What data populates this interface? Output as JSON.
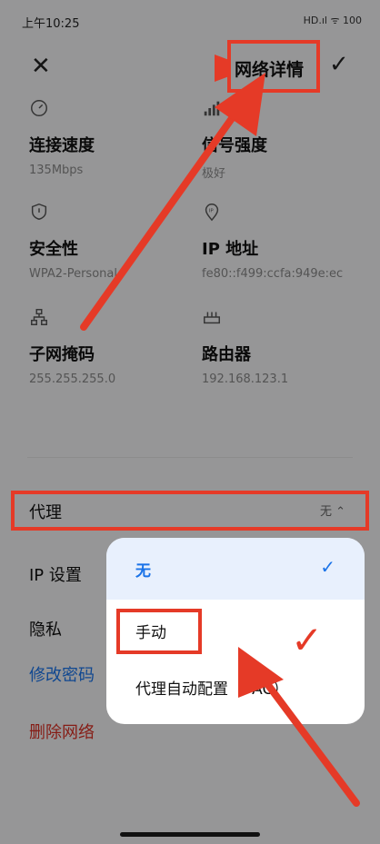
{
  "status_bar": {
    "time": "上午10:25",
    "right": "HD.ıl  ᯤ  100"
  },
  "header": {
    "close_icon": "close-icon",
    "title": "网络详情",
    "confirm_icon": "check-icon"
  },
  "info_tiles": [
    {
      "icon": "speed-icon",
      "label": "连接速度",
      "value": "135Mbps"
    },
    {
      "icon": "signal-icon",
      "label": "信号强度",
      "value": "极好"
    },
    {
      "icon": "shield-icon",
      "label": "安全性",
      "value": "WPA2-Personal"
    },
    {
      "icon": "location-pin-icon",
      "label": "IP 地址",
      "value": "fe80::f499:ccfa:949e:ec"
    },
    {
      "icon": "network-icon",
      "label": "子网掩码",
      "value": "255.255.255.0"
    },
    {
      "icon": "router-icon",
      "label": "路由器",
      "value": "192.168.123.1"
    }
  ],
  "proxy": {
    "label": "代理",
    "value": "无 ⌃"
  },
  "settings": {
    "ip_settings": "IP 设置",
    "privacy": "隐私",
    "change_password": "修改密码",
    "delete_network": "删除网络"
  },
  "popup": {
    "options": [
      {
        "label": "无",
        "selected": true
      },
      {
        "label": "手动",
        "selected": false
      },
      {
        "label": "代理自动配置（PAC）",
        "selected": false
      }
    ]
  },
  "colors": {
    "accent": "#1a73e8",
    "danger": "#d93025",
    "annotation": "#e53a27"
  }
}
